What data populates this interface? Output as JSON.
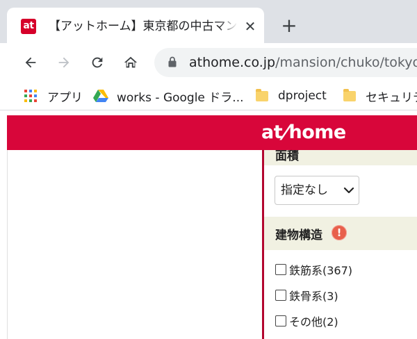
{
  "browser": {
    "tab": {
      "favicon_text": "at",
      "title": "【アットホーム】東京都の中古マンション",
      "close_glyph": "✕"
    },
    "new_tab_glyph": "+",
    "url": {
      "host": "athome.co.jp",
      "path": "/mansion/chuko/tokyo"
    },
    "bookmarks": [
      {
        "label": "アプリ",
        "icon": "apps-grid-icon"
      },
      {
        "label": "works - Google ドラ...",
        "icon": "google-drive-icon"
      },
      {
        "label": "dproject",
        "icon": "folder-icon"
      },
      {
        "label": "セキュリティ",
        "icon": "folder-icon"
      }
    ]
  },
  "site": {
    "logo": {
      "part1": "at",
      "slash": "/",
      "part2": "home"
    },
    "accent": "#d8063a"
  },
  "filters": {
    "area": {
      "heading": "面積",
      "select_value": "指定なし"
    },
    "structure": {
      "heading": "建物構造",
      "info_icon": "!",
      "options": [
        {
          "label": "鉄筋系(367)",
          "checked": false
        },
        {
          "label": "鉄骨系(3)",
          "checked": false
        },
        {
          "label": "その他(2)",
          "checked": false
        }
      ]
    }
  }
}
